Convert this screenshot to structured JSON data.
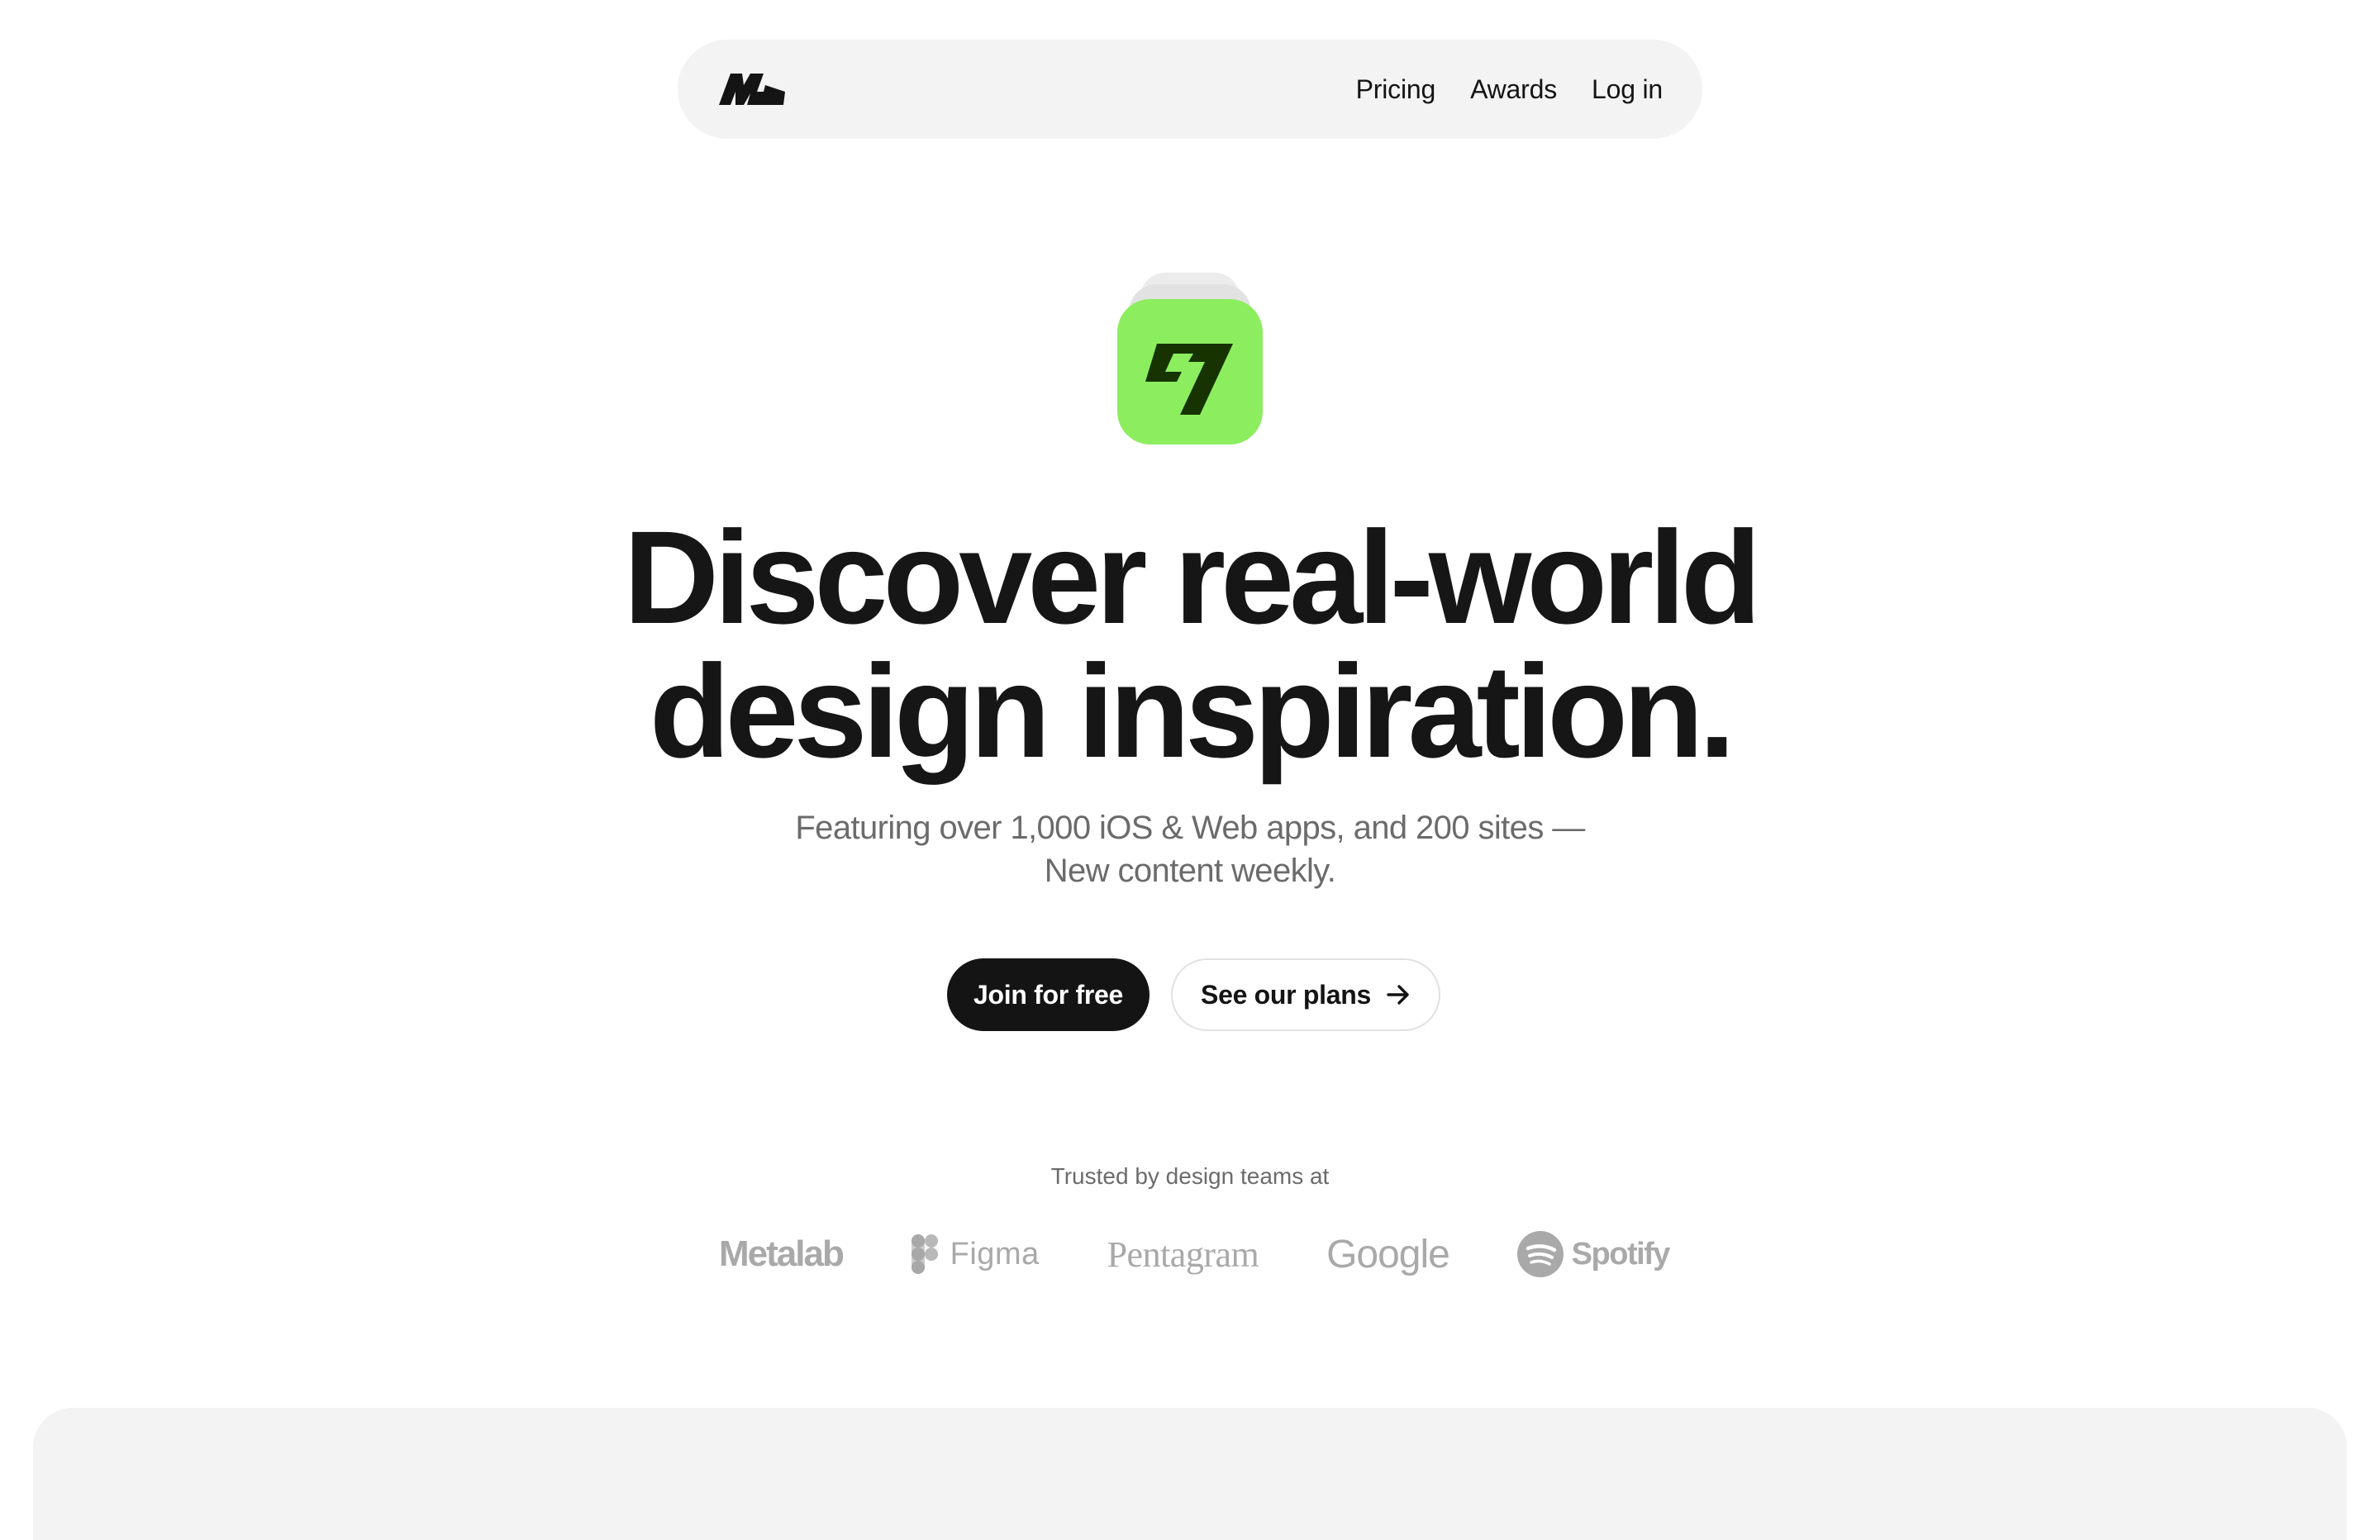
{
  "nav": {
    "logo": "mobbin-logo-icon",
    "links": [
      "Pricing",
      "Awards",
      "Log in"
    ]
  },
  "hero": {
    "app_icon": "wise-app-icon",
    "app_icon_color": "#8ced5f",
    "title_line1": "Discover real-world",
    "title_line2": "design inspiration.",
    "subtitle_line1": "Featuring over 1,000 iOS & Web apps, and 200 sites —",
    "subtitle_line2": "New content weekly."
  },
  "cta": {
    "primary": "Join for free",
    "secondary": "See our plans",
    "secondary_icon": "arrow-right-icon"
  },
  "trusted": {
    "label": "Trusted by design teams at",
    "brands": [
      "Metalab",
      "Figma",
      "Pentagram",
      "Google",
      "Spotify"
    ]
  }
}
